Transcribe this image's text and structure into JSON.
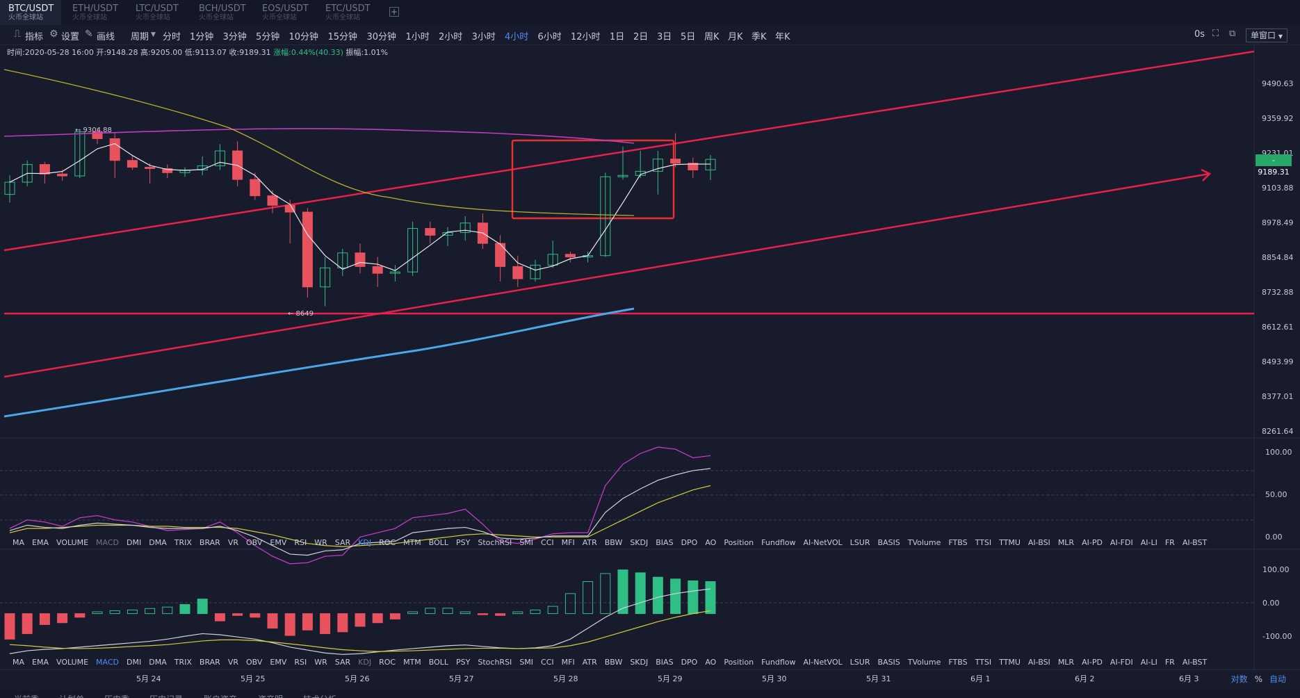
{
  "tabs": [
    {
      "pair": "BTC/USDT",
      "exchange": "火币全球站",
      "active": true
    },
    {
      "pair": "ETH/USDT",
      "exchange": "火币全球站",
      "active": false
    },
    {
      "pair": "LTC/USDT",
      "exchange": "火币全球站",
      "active": false
    },
    {
      "pair": "BCH/USDT",
      "exchange": "火币全球站",
      "active": false
    },
    {
      "pair": "EOS/USDT",
      "exchange": "火币全球站",
      "active": false
    },
    {
      "pair": "ETC/USDT",
      "exchange": "火币全球站",
      "active": false
    }
  ],
  "add_tab_label": "+",
  "toolbar": {
    "indicator": "指标",
    "settings": "设置",
    "draw": "画线",
    "period": "周期",
    "intervals": [
      "分时",
      "1分钟",
      "3分钟",
      "5分钟",
      "10分钟",
      "15分钟",
      "30分钟",
      "1小时",
      "2小时",
      "3小时",
      "4小时",
      "6小时",
      "12小时",
      "1日",
      "2日",
      "3日",
      "5日",
      "周K",
      "月K",
      "季K",
      "年K"
    ],
    "active_interval": "4小时",
    "delay": "0s",
    "window_mode": "单窗口"
  },
  "ohlc": {
    "time": "时间:2020-05-28 16:00",
    "open": "开:9148.28",
    "high": "高:9205.00",
    "low": "低:9113.07",
    "close": "收:9189.31",
    "change": "涨幅:0.44%(40.33)",
    "amplitude": "振幅:1.01%"
  },
  "price_axis": [
    "9490.63",
    "9359.92",
    "9231.01",
    "9103.88",
    "8978.49",
    "8854.84",
    "8732.88",
    "8612.61",
    "8493.99",
    "8377.01",
    "8261.64"
  ],
  "current_price": "9189.31",
  "annotations": {
    "high_marker": "← 9304.88",
    "low_marker": "← 8649"
  },
  "kdj_axis": [
    "100.00",
    "50.00",
    "0.00"
  ],
  "macd_axis": [
    "100.00",
    "0.00",
    "-100.00"
  ],
  "indicators": [
    "MA",
    "EMA",
    "VOLUME",
    "MACD",
    "DMI",
    "DMA",
    "TRIX",
    "BRAR",
    "VR",
    "OBV",
    "EMV",
    "RSI",
    "WR",
    "SAR",
    "KDJ",
    "ROC",
    "MTM",
    "BOLL",
    "PSY",
    "StochRSI",
    "SMI",
    "CCI",
    "MFI",
    "ATR",
    "BBW",
    "SKDJ",
    "BIAS",
    "DPO",
    "AO",
    "Position",
    "Fundflow",
    "AI-NetVOL",
    "LSUR",
    "BASIS",
    "TVolume",
    "FTBS",
    "TTSI",
    "TTMU",
    "AI-BSI",
    "MLR",
    "AI-PD",
    "AI-FDI",
    "AI-LI",
    "FR",
    "AI-BST"
  ],
  "indicator_row1_active": "KDJ",
  "indicator_row1_dim": "MACD",
  "indicator_row2_active": "MACD",
  "indicator_row2_dim": "KDJ",
  "x_axis": [
    "5月 24",
    "5月 25",
    "5月 26",
    "5月 27",
    "5月 28",
    "5月 29",
    "5月 30",
    "5月 31",
    "6月 1",
    "6月 2",
    "6月 3"
  ],
  "scale": {
    "log": "对数",
    "percent": "%",
    "auto": "自动"
  },
  "bottom_tabs": [
    "当前委",
    "计划单",
    "历史委",
    "历史记录",
    "账户资产",
    "资产明",
    "技术分析"
  ],
  "colors": {
    "up": "#2fbf86",
    "down": "#e8525f",
    "trend": "#e8204a",
    "ma_magenta": "#c23bc2",
    "ma_yellow": "#b8b02a",
    "ma_blue": "#4aa8e8",
    "box": "#e83030"
  },
  "chart_data": {
    "type": "candlestick",
    "interval": "4小时",
    "candles": [
      [
        9060,
        9130,
        9030,
        9105
      ],
      [
        9105,
        9185,
        9090,
        9170
      ],
      [
        9170,
        9180,
        9100,
        9135
      ],
      [
        9135,
        9150,
        9110,
        9128
      ],
      [
        9128,
        9300,
        9120,
        9290
      ],
      [
        9290,
        9305,
        9245,
        9265
      ],
      [
        9265,
        9285,
        9120,
        9185
      ],
      [
        9185,
        9205,
        9150,
        9160
      ],
      [
        9160,
        9175,
        9100,
        9155
      ],
      [
        9155,
        9170,
        9120,
        9140
      ],
      [
        9140,
        9160,
        9125,
        9150
      ],
      [
        9150,
        9200,
        9130,
        9165
      ],
      [
        9165,
        9245,
        9150,
        9220
      ],
      [
        9220,
        9255,
        9090,
        9115
      ],
      [
        9115,
        9140,
        9040,
        9055
      ],
      [
        9055,
        9075,
        8990,
        9020
      ],
      [
        9020,
        9040,
        8880,
        8995
      ],
      [
        8995,
        9010,
        8680,
        8720
      ],
      [
        8720,
        8830,
        8649,
        8790
      ],
      [
        8790,
        8860,
        8760,
        8845
      ],
      [
        8845,
        8880,
        8770,
        8795
      ],
      [
        8795,
        8830,
        8720,
        8770
      ],
      [
        8770,
        8800,
        8740,
        8775
      ],
      [
        8775,
        8960,
        8760,
        8935
      ],
      [
        8935,
        8960,
        8880,
        8910
      ],
      [
        8910,
        8940,
        8870,
        8920
      ],
      [
        8920,
        8980,
        8890,
        8955
      ],
      [
        8955,
        8990,
        8860,
        8880
      ],
      [
        8880,
        8910,
        8740,
        8795
      ],
      [
        8795,
        8835,
        8720,
        8750
      ],
      [
        8750,
        8820,
        8740,
        8800
      ],
      [
        8800,
        8890,
        8790,
        8840
      ],
      [
        8840,
        8850,
        8810,
        8830
      ],
      [
        8830,
        8850,
        8810,
        8835
      ],
      [
        8835,
        9140,
        8830,
        9125
      ],
      [
        9125,
        9235,
        9115,
        9130
      ],
      [
        9130,
        9220,
        9120,
        9145
      ],
      [
        9145,
        9220,
        9060,
        9190
      ],
      [
        9190,
        9285,
        9160,
        9175
      ],
      [
        9175,
        9195,
        9120,
        9150
      ],
      [
        9150,
        9205,
        9113,
        9189
      ]
    ],
    "price_range": [
      8180,
      9560
    ],
    "kdj_range": [
      -5,
      108
    ],
    "macd_range": [
      -140,
      150
    ]
  }
}
